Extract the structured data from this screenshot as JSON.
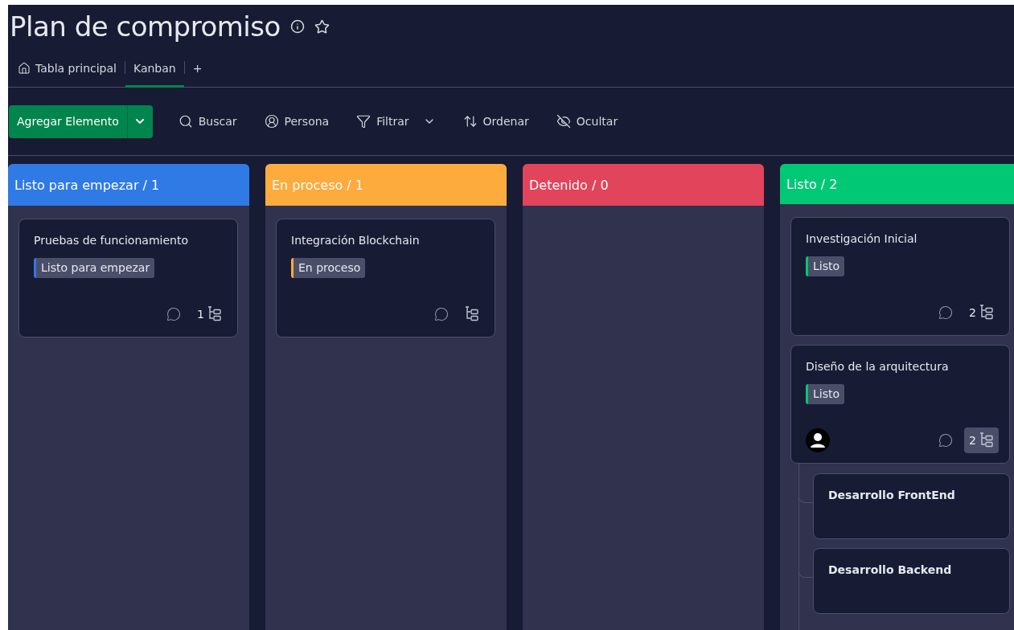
{
  "board": {
    "title": "Plan de compromiso"
  },
  "views": [
    {
      "label": "Tabla principal",
      "kind": "home",
      "selected": false
    },
    {
      "label": "Kanban",
      "kind": "plain",
      "selected": true
    }
  ],
  "add_view": "+",
  "toolbar": {
    "primary": "Agregar Elemento",
    "actions": [
      {
        "label": "Buscar",
        "kind": "search"
      },
      {
        "label": "Persona",
        "kind": "person"
      },
      {
        "label": "Filtrar",
        "kind": "filter"
      },
      {
        "label": "Ordenar",
        "kind": "sort"
      },
      {
        "label": "Ocultar",
        "kind": "hide"
      }
    ]
  },
  "columns": [
    {
      "title": "Listo para empezar / 1",
      "color": "#2f7ae5",
      "cards": [
        {
          "title": "Pruebas de funcionamiento",
          "status": {
            "label": "Listo para empezar",
            "color": "#2f7ae5"
          },
          "subitem_count": "1",
          "assigned": false,
          "expanded": false
        }
      ]
    },
    {
      "title": "En proceso / 1",
      "color": "#fdab3d",
      "cards": [
        {
          "title": "Integración Blockchain",
          "status": {
            "label": "En proceso",
            "color": "#fdab3d"
          },
          "assigned": false,
          "expanded": false
        }
      ]
    },
    {
      "title": "Detenido / 0",
      "color": "#e2445c"
    },
    {
      "title": "Listo / 2",
      "color": "#00c875",
      "cards": [
        {
          "title": "Investigación Inicial",
          "status": {
            "label": "Listo",
            "color": "#00c875"
          },
          "subitem_count": "2",
          "assigned": false,
          "expanded": false
        },
        {
          "title": "Diseño de la arquitectura",
          "status": {
            "label": "Listo",
            "color": "#00c875"
          },
          "subitem_count": "2",
          "assigned": true,
          "expanded": true,
          "children": [
            {
              "title": "Desarrollo FrontEnd"
            },
            {
              "title": "Desarrollo Backend"
            }
          ]
        }
      ]
    }
  ]
}
